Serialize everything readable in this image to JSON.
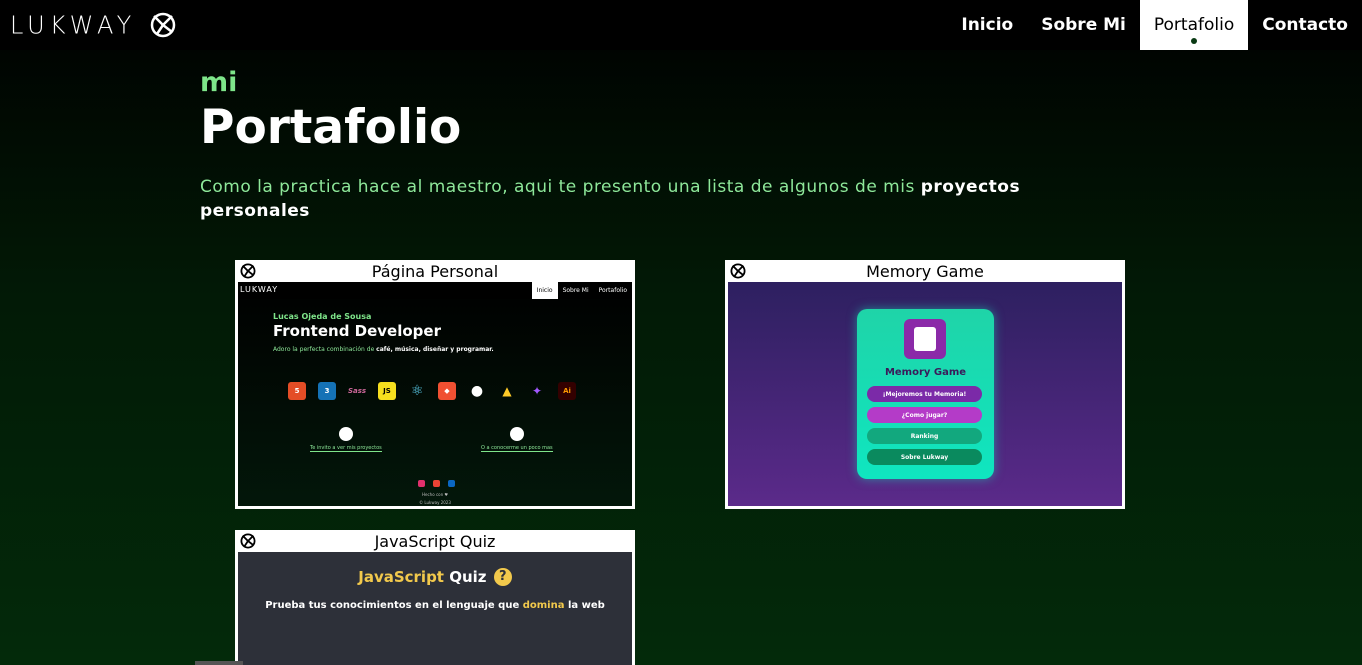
{
  "nav": {
    "logo": "LUKWAY",
    "items": [
      {
        "label": "Inicio",
        "active": false
      },
      {
        "label": "Sobre Mi",
        "active": false
      },
      {
        "label": "Portafolio",
        "active": true
      },
      {
        "label": "Contacto",
        "active": false
      }
    ]
  },
  "hero": {
    "eyebrow": "mi",
    "title": "Portafolio",
    "intro": "Como la practica hace al maestro, aqui te presento una lista de algunos de mis ",
    "intro_bold": "proyectos personales"
  },
  "projects": [
    {
      "title": "Página Personal",
      "preview": {
        "nav_logo": "LUKWAY",
        "nav_items": [
          "Inicio",
          "Sobre Mi",
          "Portafolio"
        ],
        "subtitle": "Lucas Ojeda de Sousa",
        "heading": "Frontend Developer",
        "desc_start": "Adoro la perfecta combinación de ",
        "desc_bold": "café, música, diseñar y programar.",
        "skills": [
          "5",
          "3",
          "Sass",
          "JS",
          "⚛",
          "◆",
          "●",
          "▲",
          "✦",
          "Ai"
        ],
        "link1": "Te invito a ver mis proyectos",
        "link2": "O a conocerme un poco mas",
        "made_with": "Hecho con ♥",
        "copyright": "© Lukway 2023"
      }
    },
    {
      "title": "Memory Game",
      "preview": {
        "heading": "Memory Game",
        "buttons": [
          "¡Mejoremos tu Memoria!",
          "¿Como jugar?",
          "Ranking",
          "Sobre Lukway"
        ]
      }
    },
    {
      "title": "JavaScript Quiz",
      "preview": {
        "heading_a": "JavaScript",
        "heading_b": " Quiz",
        "icon": "?",
        "sub_a": "Prueba tus conocimientos en el lenguaje que ",
        "sub_b": "domina",
        "sub_c": " la web"
      }
    }
  ],
  "colors": {
    "accent": "#7ee58a",
    "nav_bg": "#000000",
    "quiz_yellow": "#f2c94c"
  }
}
